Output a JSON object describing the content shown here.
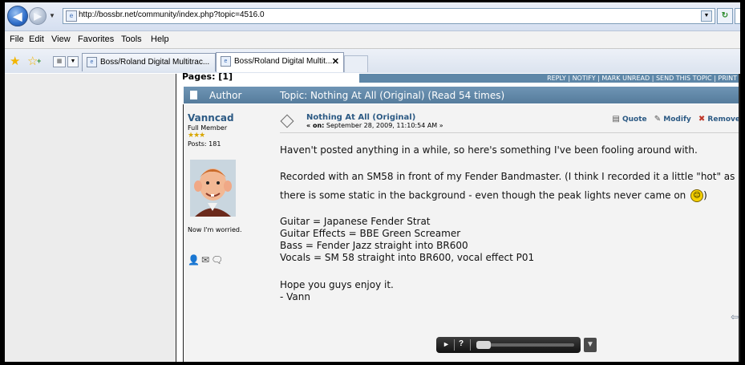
{
  "browser": {
    "url": "http://bossbr.net/community/index.php?topic=4516.0",
    "menu": [
      "File",
      "Edit",
      "View",
      "Favorites",
      "Tools",
      "Help"
    ],
    "tabs": [
      {
        "label": "Boss/Roland Digital Multitrac...",
        "active": false
      },
      {
        "label": "Boss/Roland Digital Multit...",
        "active": true
      }
    ]
  },
  "page": {
    "pages_label": "Pages: [1]",
    "actions": "REPLY | NOTIFY | MARK UNREAD | SEND THIS TOPIC | PRINT",
    "header_author": "Author",
    "header_topic": "Topic: Nothing At All (Original)  (Read 54 times)"
  },
  "poster": {
    "name": "Vanncad",
    "rank": "Full Member",
    "stars": "★★★",
    "posts": "Posts: 181",
    "personal_text": "Now I'm worried."
  },
  "message": {
    "title": "Nothing At All (Original)",
    "date_prefix": "« on:",
    "date": "September 28, 2009, 11:10:54 AM »",
    "buttons": {
      "quote": "Quote",
      "modify": "Modify",
      "remove": "Remove"
    },
    "line1": "Haven't posted anything in a while, so here's something I've been fooling around with.",
    "line2": "Recorded with an SM58 in front of my Fender Bandmaster. (I think I recorded it a little \"hot\" as",
    "line3": "there is some static in the background - even though the peak lights never came on",
    "line4": "Guitar = Japanese Fender Strat",
    "line5": "Guitar Effects = BBE Green Screamer",
    "line6": "Bass = Fender Jazz straight into BR600",
    "line7": "Vocals = SM 58 straight into BR600, vocal effect P01",
    "line8": "Hope you guys enjoy it.",
    "line9": " - Vann",
    "smiley_after": ")"
  },
  "player": {
    "play": "►",
    "help": "?"
  }
}
